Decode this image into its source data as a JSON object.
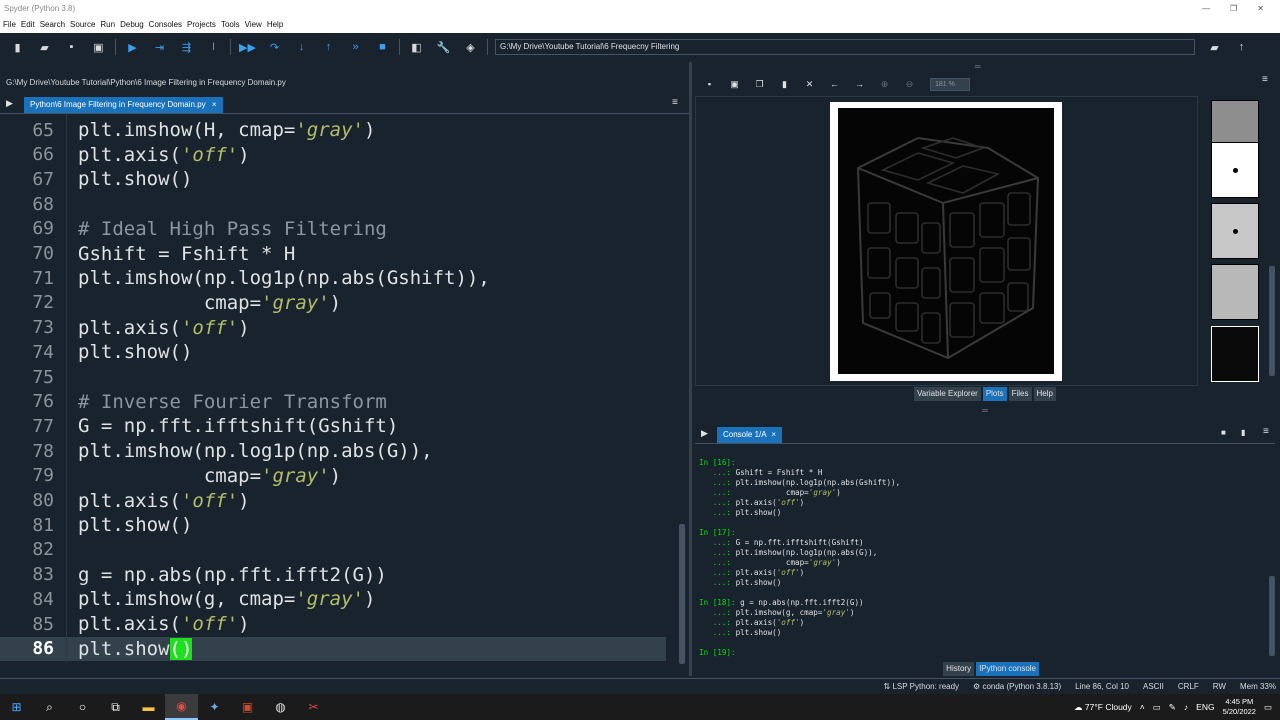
{
  "window": {
    "title": "Spyder (Python 3.8)",
    "minimize": "—",
    "restore": "❐",
    "close": "✕"
  },
  "menu": [
    "File",
    "Edit",
    "Search",
    "Source",
    "Run",
    "Debug",
    "Consoles",
    "Projects",
    "Tools",
    "View",
    "Help"
  ],
  "toolbar": {
    "path": "G:\\My Drive\\Youtube Tutorial\\6 Frequecny Filtering"
  },
  "editor": {
    "file_path": "G:\\My Drive\\Youtube Tutorial\\Python\\6 Image Filtering in Frequency Domain.py",
    "tab_label": "Python\\6 Image Filtering in Frequency Domain.py",
    "tab_close": "×",
    "current_line": "86",
    "lines": [
      {
        "n": "65",
        "code": [
          {
            "t": "plt.imshow(H, cmap="
          },
          {
            "t": "'gray'",
            "c": "str"
          },
          {
            "t": ")"
          }
        ]
      },
      {
        "n": "66",
        "code": [
          {
            "t": "plt.axis("
          },
          {
            "t": "'off'",
            "c": "str"
          },
          {
            "t": ")"
          }
        ]
      },
      {
        "n": "67",
        "code": [
          {
            "t": "plt.show()"
          }
        ]
      },
      {
        "n": "68",
        "code": []
      },
      {
        "n": "69",
        "code": [
          {
            "t": "# Ideal High Pass Filtering",
            "c": "cmt"
          }
        ]
      },
      {
        "n": "70",
        "code": [
          {
            "t": "Gshift = Fshift * H"
          }
        ]
      },
      {
        "n": "71",
        "code": [
          {
            "t": "plt.imshow(np.log1p(np.abs(Gshift)),"
          }
        ]
      },
      {
        "n": "72",
        "code": [
          {
            "t": "           cmap="
          },
          {
            "t": "'gray'",
            "c": "str"
          },
          {
            "t": ")"
          }
        ]
      },
      {
        "n": "73",
        "code": [
          {
            "t": "plt.axis("
          },
          {
            "t": "'off'",
            "c": "str"
          },
          {
            "t": ")"
          }
        ]
      },
      {
        "n": "74",
        "code": [
          {
            "t": "plt.show()"
          }
        ]
      },
      {
        "n": "75",
        "code": []
      },
      {
        "n": "76",
        "code": [
          {
            "t": "# Inverse Fourier Transform",
            "c": "cmt"
          }
        ]
      },
      {
        "n": "77",
        "code": [
          {
            "t": "G = np.fft.ifftshift(Gshift)"
          }
        ]
      },
      {
        "n": "78",
        "code": [
          {
            "t": "plt.imshow(np.log1p(np.abs(G)),"
          }
        ]
      },
      {
        "n": "79",
        "code": [
          {
            "t": "           cmap="
          },
          {
            "t": "'gray'",
            "c": "str"
          },
          {
            "t": ")"
          }
        ]
      },
      {
        "n": "80",
        "code": [
          {
            "t": "plt.axis("
          },
          {
            "t": "'off'",
            "c": "str"
          },
          {
            "t": ")"
          }
        ]
      },
      {
        "n": "81",
        "code": [
          {
            "t": "plt.show()"
          }
        ]
      },
      {
        "n": "82",
        "code": []
      },
      {
        "n": "83",
        "code": [
          {
            "t": "g = np.abs(np.fft.ifft2(G))"
          }
        ]
      },
      {
        "n": "84",
        "code": [
          {
            "t": "plt.imshow(g, cmap="
          },
          {
            "t": "'gray'",
            "c": "str"
          },
          {
            "t": ")"
          }
        ]
      },
      {
        "n": "85",
        "code": [
          {
            "t": "plt.axis("
          },
          {
            "t": "'off'",
            "c": "str"
          },
          {
            "t": ")"
          }
        ]
      },
      {
        "n": "86",
        "code": [
          {
            "t": "plt.show"
          },
          {
            "t": "()",
            "c": "paren-hl"
          }
        ]
      }
    ]
  },
  "plots": {
    "zoom": "181 %",
    "tabs": [
      "Variable Explorer",
      "Plots",
      "Files",
      "Help"
    ],
    "active_tab": "Plots"
  },
  "console": {
    "tab_label": "Console 1/A",
    "tab_close": "×",
    "lines": [
      {
        "p": "In [16]:",
        "code": []
      },
      {
        "p": "   ...:",
        "code": [
          {
            "t": " Gshift = Fshift * H"
          }
        ]
      },
      {
        "p": "   ...:",
        "code": [
          {
            "t": " plt.imshow(np.log1p(np.abs(Gshift)),"
          }
        ]
      },
      {
        "p": "   ...:",
        "code": [
          {
            "t": "            cmap="
          },
          {
            "t": "'gray'",
            "c": "cstr"
          },
          {
            "t": ")"
          }
        ]
      },
      {
        "p": "   ...:",
        "code": [
          {
            "t": " plt.axis("
          },
          {
            "t": "'off'",
            "c": "cstr"
          },
          {
            "t": ")"
          }
        ]
      },
      {
        "p": "   ...:",
        "code": [
          {
            "t": " plt.show()"
          }
        ]
      },
      {
        "p": "",
        "code": []
      },
      {
        "p": "In [17]:",
        "code": []
      },
      {
        "p": "   ...:",
        "code": [
          {
            "t": " G = np.fft.ifftshift(Gshift)"
          }
        ]
      },
      {
        "p": "   ...:",
        "code": [
          {
            "t": " plt.imshow(np.log1p(np.abs(G)),"
          }
        ]
      },
      {
        "p": "   ...:",
        "code": [
          {
            "t": "            cmap="
          },
          {
            "t": "'gray'",
            "c": "cstr"
          },
          {
            "t": ")"
          }
        ]
      },
      {
        "p": "   ...:",
        "code": [
          {
            "t": " plt.axis("
          },
          {
            "t": "'off'",
            "c": "cstr"
          },
          {
            "t": ")"
          }
        ]
      },
      {
        "p": "   ...:",
        "code": [
          {
            "t": " plt.show()"
          }
        ]
      },
      {
        "p": "",
        "code": []
      },
      {
        "p": "In [18]:",
        "code": [
          {
            "t": " g = np.abs(np.fft.ifft2(G))"
          }
        ]
      },
      {
        "p": "   ...:",
        "code": [
          {
            "t": " plt.imshow(g, cmap="
          },
          {
            "t": "'gray'",
            "c": "cstr"
          },
          {
            "t": ")"
          }
        ]
      },
      {
        "p": "   ...:",
        "code": [
          {
            "t": " plt.axis("
          },
          {
            "t": "'off'",
            "c": "cstr"
          },
          {
            "t": ")"
          }
        ]
      },
      {
        "p": "   ...:",
        "code": [
          {
            "t": " plt.show()"
          }
        ]
      },
      {
        "p": "",
        "code": []
      },
      {
        "p": "In [19]:",
        "code": []
      }
    ],
    "bottom_tabs": [
      "History",
      "IPython console"
    ],
    "active_bottom_tab": "IPython console"
  },
  "status": {
    "lsp": "LSP Python: ready",
    "env": "conda (Python 3.8.13)",
    "position": "Line 86, Col 10",
    "encoding": "ASCII",
    "eol": "CRLF",
    "mode": "RW",
    "memory": "Mem 33%"
  },
  "taskbar": {
    "weather": "77°F  Cloudy",
    "lang": "ENG",
    "time": "4:45 PM",
    "date": "5/20/2022"
  },
  "colors": {
    "accent": "#1a72bb",
    "bg": "#19232d",
    "match": "#1ee01e"
  }
}
